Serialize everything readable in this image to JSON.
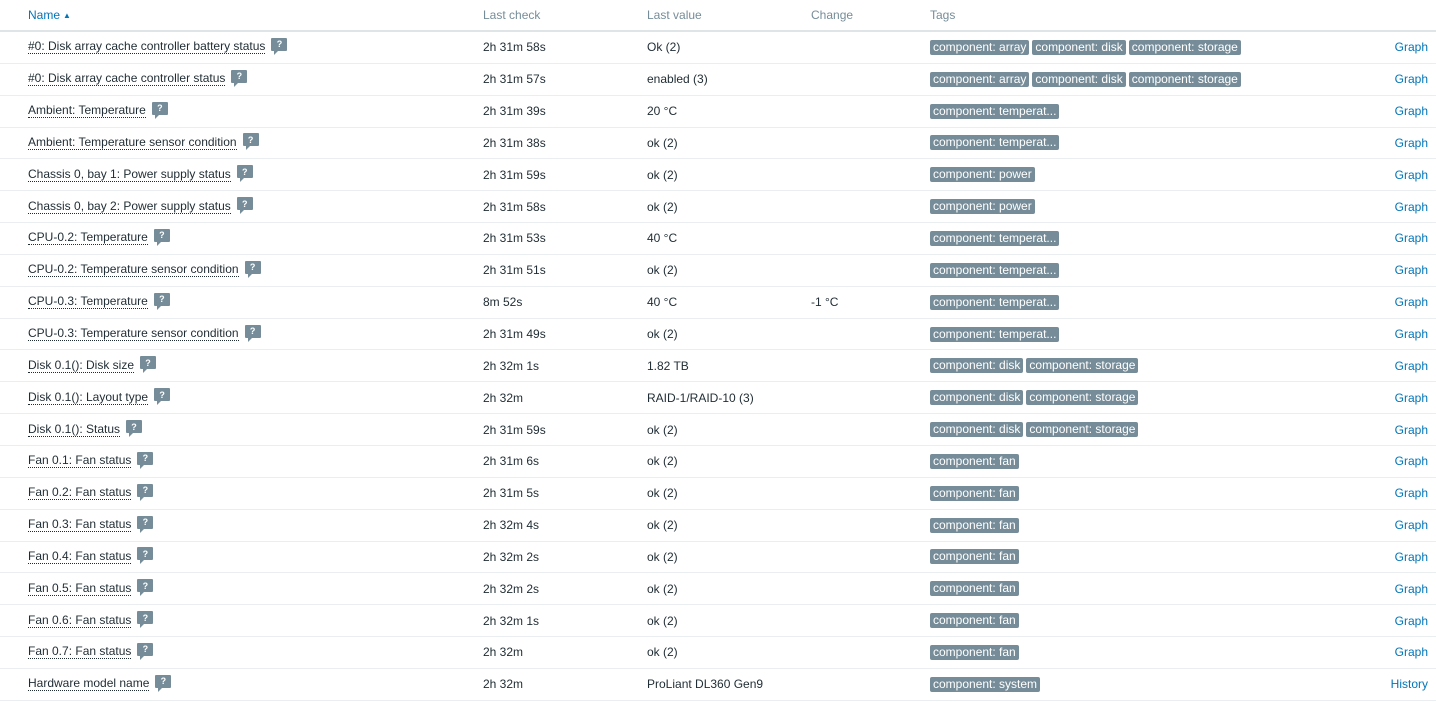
{
  "columns": {
    "name": "Name",
    "last_check": "Last check",
    "last_value": "Last value",
    "change": "Change",
    "tags": "Tags"
  },
  "hint_symbol": "?",
  "sort_indicator": "▲",
  "rows": [
    {
      "name": "#0: Disk array cache controller battery status",
      "last_check": "2h 31m 58s",
      "last_value": "Ok (2)",
      "change": "",
      "tags": [
        "component: array",
        "component: disk",
        "component: storage"
      ],
      "action": "Graph"
    },
    {
      "name": "#0: Disk array cache controller status",
      "last_check": "2h 31m 57s",
      "last_value": "enabled (3)",
      "change": "",
      "tags": [
        "component: array",
        "component: disk",
        "component: storage"
      ],
      "action": "Graph"
    },
    {
      "name": "Ambient: Temperature",
      "last_check": "2h 31m 39s",
      "last_value": "20 °C",
      "change": "",
      "tags": [
        "component: temperat..."
      ],
      "action": "Graph"
    },
    {
      "name": "Ambient: Temperature sensor condition",
      "last_check": "2h 31m 38s",
      "last_value": "ok (2)",
      "change": "",
      "tags": [
        "component: temperat..."
      ],
      "action": "Graph"
    },
    {
      "name": "Chassis 0, bay 1: Power supply status",
      "last_check": "2h 31m 59s",
      "last_value": "ok (2)",
      "change": "",
      "tags": [
        "component: power"
      ],
      "action": "Graph"
    },
    {
      "name": "Chassis 0, bay 2: Power supply status",
      "last_check": "2h 31m 58s",
      "last_value": "ok (2)",
      "change": "",
      "tags": [
        "component: power"
      ],
      "action": "Graph"
    },
    {
      "name": "CPU-0.2: Temperature",
      "last_check": "2h 31m 53s",
      "last_value": "40 °C",
      "change": "",
      "tags": [
        "component: temperat..."
      ],
      "action": "Graph"
    },
    {
      "name": "CPU-0.2: Temperature sensor condition",
      "last_check": "2h 31m 51s",
      "last_value": "ok (2)",
      "change": "",
      "tags": [
        "component: temperat..."
      ],
      "action": "Graph"
    },
    {
      "name": "CPU-0.3: Temperature",
      "last_check": "8m 52s",
      "last_value": "40 °C",
      "change": "-1 °C",
      "tags": [
        "component: temperat..."
      ],
      "action": "Graph"
    },
    {
      "name": "CPU-0.3: Temperature sensor condition",
      "last_check": "2h 31m 49s",
      "last_value": "ok (2)",
      "change": "",
      "tags": [
        "component: temperat..."
      ],
      "action": "Graph"
    },
    {
      "name": "Disk 0.1(): Disk size",
      "last_check": "2h 32m 1s",
      "last_value": "1.82 TB",
      "change": "",
      "tags": [
        "component: disk",
        "component: storage"
      ],
      "action": "Graph"
    },
    {
      "name": "Disk 0.1(): Layout type",
      "last_check": "2h 32m",
      "last_value": "RAID-1/RAID-10 (3)",
      "change": "",
      "tags": [
        "component: disk",
        "component: storage"
      ],
      "action": "Graph"
    },
    {
      "name": "Disk 0.1(): Status",
      "last_check": "2h 31m 59s",
      "last_value": "ok (2)",
      "change": "",
      "tags": [
        "component: disk",
        "component: storage"
      ],
      "action": "Graph"
    },
    {
      "name": "Fan 0.1: Fan status",
      "last_check": "2h 31m 6s",
      "last_value": "ok (2)",
      "change": "",
      "tags": [
        "component: fan"
      ],
      "action": "Graph"
    },
    {
      "name": "Fan 0.2: Fan status",
      "last_check": "2h 31m 5s",
      "last_value": "ok (2)",
      "change": "",
      "tags": [
        "component: fan"
      ],
      "action": "Graph"
    },
    {
      "name": "Fan 0.3: Fan status",
      "last_check": "2h 32m 4s",
      "last_value": "ok (2)",
      "change": "",
      "tags": [
        "component: fan"
      ],
      "action": "Graph"
    },
    {
      "name": "Fan 0.4: Fan status",
      "last_check": "2h 32m 2s",
      "last_value": "ok (2)",
      "change": "",
      "tags": [
        "component: fan"
      ],
      "action": "Graph"
    },
    {
      "name": "Fan 0.5: Fan status",
      "last_check": "2h 32m 2s",
      "last_value": "ok (2)",
      "change": "",
      "tags": [
        "component: fan"
      ],
      "action": "Graph"
    },
    {
      "name": "Fan 0.6: Fan status",
      "last_check": "2h 32m 1s",
      "last_value": "ok (2)",
      "change": "",
      "tags": [
        "component: fan"
      ],
      "action": "Graph"
    },
    {
      "name": "Fan 0.7: Fan status",
      "last_check": "2h 32m",
      "last_value": "ok (2)",
      "change": "",
      "tags": [
        "component: fan"
      ],
      "action": "Graph"
    },
    {
      "name": "Hardware model name",
      "last_check": "2h 32m",
      "last_value": "ProLiant DL360 Gen9",
      "change": "",
      "tags": [
        "component: system"
      ],
      "action": "History"
    }
  ]
}
